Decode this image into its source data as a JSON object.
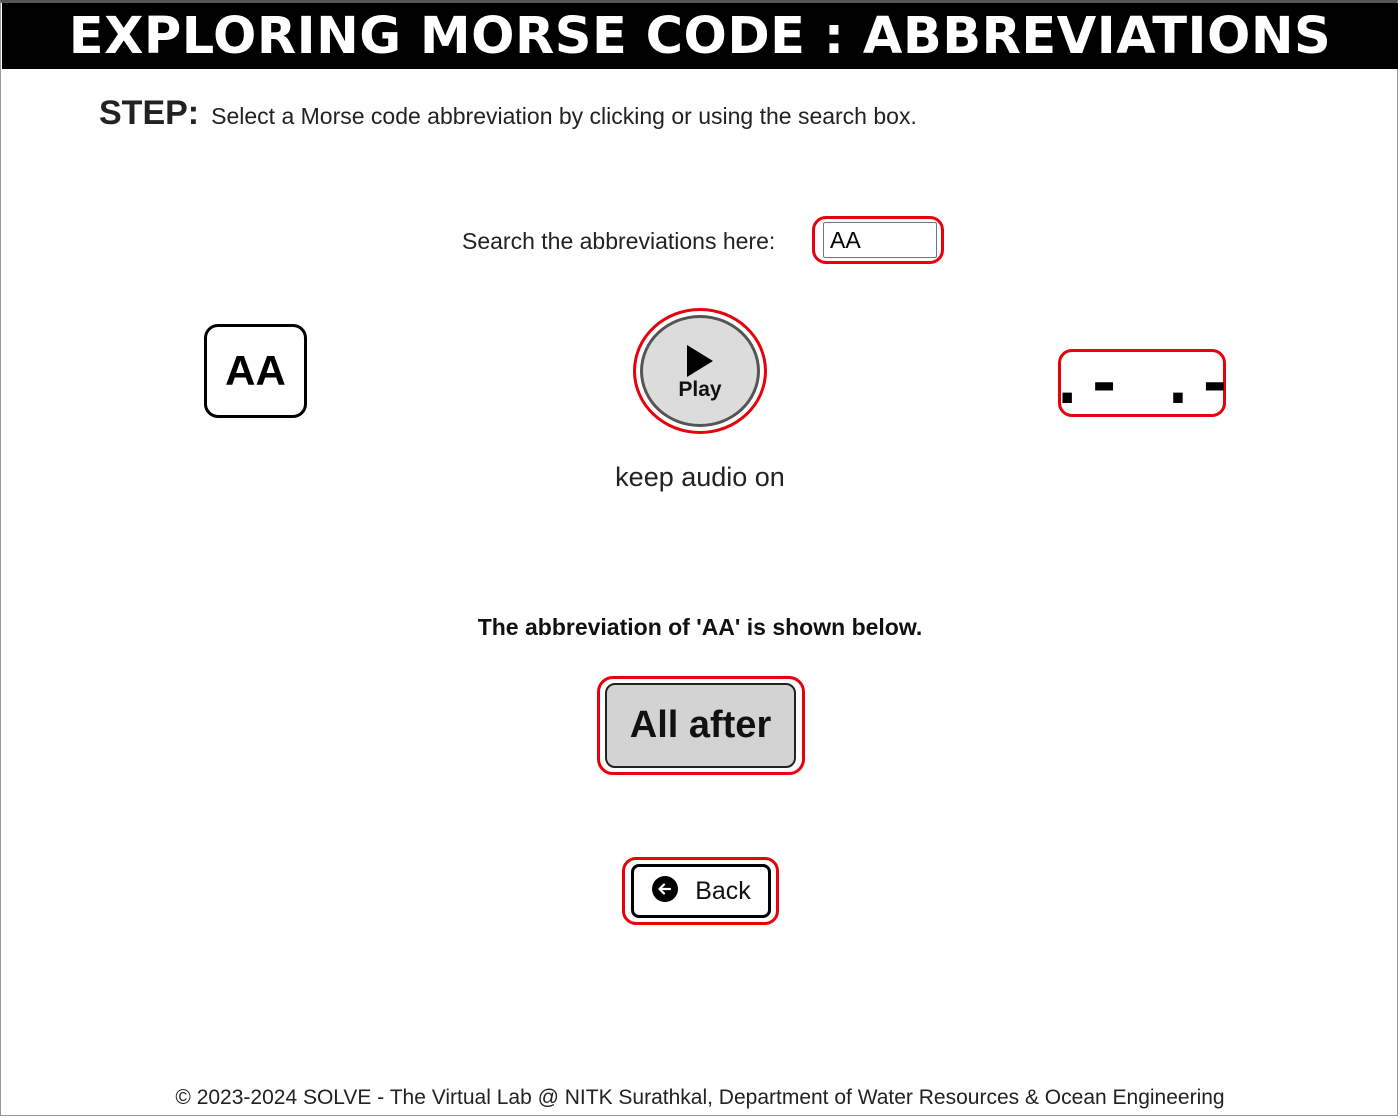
{
  "header": {
    "title": "EXPLORING MORSE CODE : ABBREVIATIONS"
  },
  "step": {
    "label": "STEP:",
    "text": "Select a Morse code abbreviation by clicking or using the search box."
  },
  "search": {
    "label": "Search the abbreviations here:",
    "value": "AA"
  },
  "display": {
    "letter": "AA",
    "play_label": "Play",
    "morse": ".- .-",
    "audio_text": "keep audio on"
  },
  "result": {
    "caption": "The abbreviation of 'AA' is shown below.",
    "meaning": "All after"
  },
  "back": {
    "label": "Back"
  },
  "footer": {
    "text": "© 2023-2024 SOLVE - The Virtual Lab @ NITK Surathkal, Department of Water Resources & Ocean Engineering"
  },
  "colors": {
    "highlight": "#e8000b",
    "header_bg": "#000000",
    "button_gray": "#d3d3d3"
  },
  "icons": {
    "play": "play-triangle-icon",
    "back": "arrow-left-circle-icon"
  }
}
